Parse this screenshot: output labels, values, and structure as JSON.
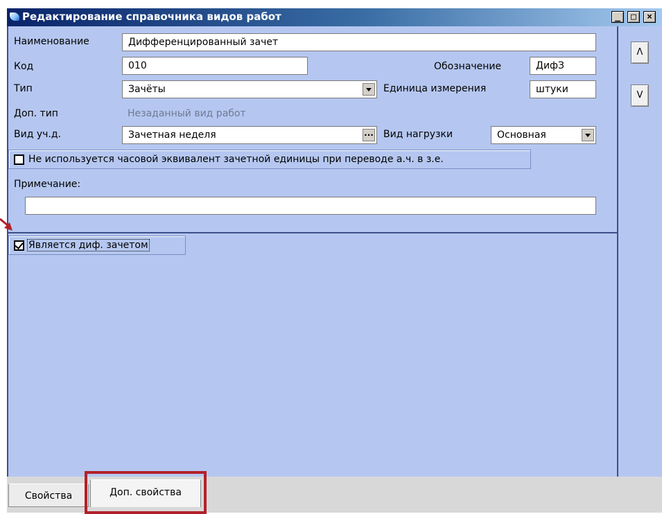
{
  "window": {
    "title": "Редактирование справочника видов работ",
    "controls": {
      "minimize": "_",
      "maximize": "□",
      "close": "×"
    }
  },
  "form": {
    "name_label": "Наименование",
    "name_value": "Дифференцированный зачет",
    "code_label": "Код",
    "code_value": "010",
    "designation_label": "Обозначение",
    "designation_value": "ДифЗ",
    "type_label": "Тип",
    "type_value": "Зачёты",
    "unit_label": "Единица измерения",
    "unit_value": "штуки",
    "extra_type_label": "Доп. тип",
    "extra_type_value": "Незаданный вид работ",
    "study_kind_label": "Вид уч.д.",
    "study_kind_value": "Зачетная неделя",
    "study_kind_button": "...",
    "load_kind_label": "Вид нагрузки",
    "load_kind_value": "Основная",
    "no_hour_equivalent_label": "Не используется часовой эквивалент зачетной единицы при переводе а.ч. в з.е.",
    "no_hour_equivalent_checked": false,
    "note_label": "Примечание:",
    "note_value": ""
  },
  "extra": {
    "is_diff_credit_label": "Является диф. зачетом",
    "is_diff_credit_checked": true
  },
  "side_buttons": {
    "up": "Λ",
    "down": "V"
  },
  "tabs": [
    {
      "label": "Свойства",
      "active": false
    },
    {
      "label": "Доп. свойства",
      "active": true
    }
  ],
  "colors": {
    "panel": "#b5c7f0",
    "highlight": "#b3202a",
    "arrow": "#b3202a"
  }
}
